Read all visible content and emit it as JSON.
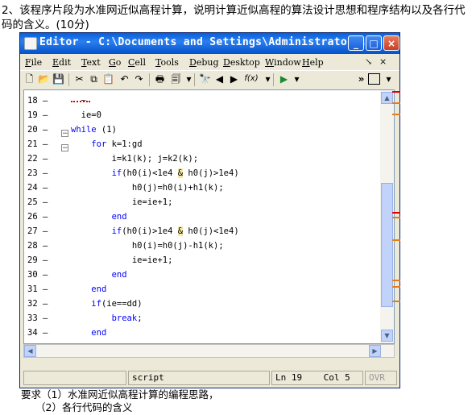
{
  "question": {
    "text": "2、该程序片段为水准网近似高程计算，说明计算近似高程的算法设计思想和程序结构以及各行代码的含义。(10分)"
  },
  "requirements": {
    "line1": "要求（1）水准网近似高程计算的编程思路，",
    "line2": "（2）各行代码的含义"
  },
  "window": {
    "title": "Editor - C:\\Documents and Settings\\Administrato...",
    "buttons": {
      "minimize": "_",
      "maximize": "□",
      "close": "×"
    }
  },
  "menu": [
    "File",
    "Edit",
    "Text",
    "Go",
    "Cell",
    "Tools",
    "Debug",
    "Desktop",
    "Window",
    "Help"
  ],
  "menu_right": {
    "dock": "↘",
    "close": "×"
  },
  "toolbar": {
    "icons": [
      "new-file-icon",
      "open-folder-icon",
      "save-icon",
      "cut-icon",
      "copy-icon",
      "paste-icon",
      "undo-icon",
      "redo-icon",
      "print-icon",
      "find-files-icon",
      "binoculars-icon",
      "back-icon",
      "forward-icon",
      "function-icon",
      "run-icon"
    ],
    "fx_label": "f(x)",
    "overflow": "»"
  },
  "editor": {
    "lines": [
      {
        "num": "18",
        "marker": "–",
        "code": "  ~"
      },
      {
        "num": "19",
        "marker": "–",
        "code": "  ie=0"
      },
      {
        "num": "20",
        "marker": "–",
        "code": "while (1)"
      },
      {
        "num": "21",
        "marker": "–",
        "code": "    for k=1:gd"
      },
      {
        "num": "22",
        "marker": "–",
        "code": "        i=k1(k); j=k2(k);"
      },
      {
        "num": "23",
        "marker": "–",
        "code": "        if(h0(i)<1e4 & h0(j)>1e4)"
      },
      {
        "num": "24",
        "marker": "–",
        "code": "            h0(j)=h0(i)+h1(k);"
      },
      {
        "num": "25",
        "marker": "–",
        "code": "            ie=ie+1;"
      },
      {
        "num": "26",
        "marker": "–",
        "code": "        end"
      },
      {
        "num": "27",
        "marker": "–",
        "code": "        if(h0(i)>1e4 & h0(j)<1e4)"
      },
      {
        "num": "28",
        "marker": "–",
        "code": "            h0(i)=h0(j)-h1(k);"
      },
      {
        "num": "29",
        "marker": "–",
        "code": "            ie=ie+1;"
      },
      {
        "num": "30",
        "marker": "–",
        "code": "        end"
      },
      {
        "num": "31",
        "marker": "–",
        "code": "    end"
      },
      {
        "num": "32",
        "marker": "–",
        "code": "    if(ie==dd)"
      },
      {
        "num": "33",
        "marker": "–",
        "code": "        break;"
      },
      {
        "num": "34",
        "marker": "–",
        "code": "    end"
      }
    ]
  },
  "statusbar": {
    "mode": "script",
    "ln_label": "Ln",
    "ln_value": "19",
    "col_label": "Col",
    "col_value": "5",
    "ovr": "OVR"
  },
  "colors": {
    "keyword": "#0000ff",
    "titlebar": "#0a5fd8",
    "marker_orange": "#e57c1c",
    "marker_red": "#e00000"
  }
}
